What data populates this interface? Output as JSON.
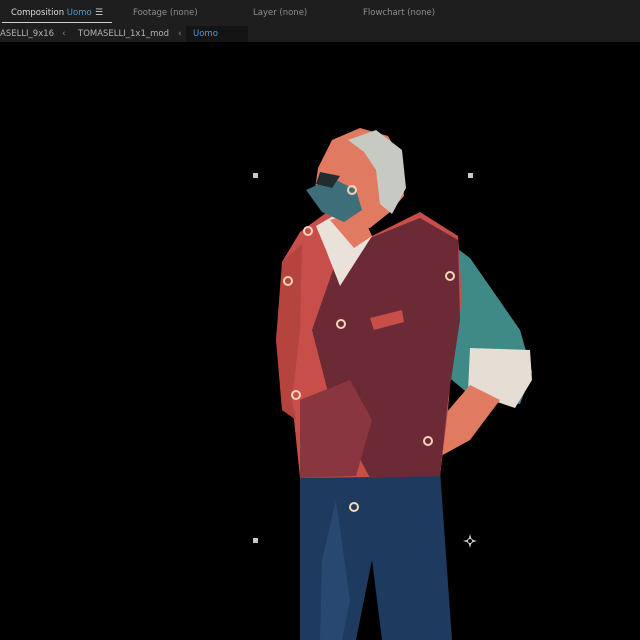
{
  "panel_tabs": {
    "composition": {
      "label": "Composition",
      "name": "Uomo",
      "menu_icon": "hamburger-menu-icon"
    },
    "footage": "Footage (none)",
    "layer": "Layer (none)",
    "flowchart": "Flowchart (none)"
  },
  "breadcrumbs": {
    "items": [
      "ASELLI_9x16",
      "TOMASELLI_1x1_mod",
      "Uomo"
    ],
    "separator_icon": "chevron-left-icon"
  },
  "viewer": {
    "background": "#000000",
    "layer_content": "illustration-man-standing",
    "colors": {
      "hair": "#c7c9c3",
      "skin": "#e07a60",
      "vest": "#c84e49",
      "vest_shadow": "#6b2a35",
      "shirt": "#3f8a87",
      "jeans": "#1e3a5f",
      "accent": "#4b9be0"
    }
  }
}
